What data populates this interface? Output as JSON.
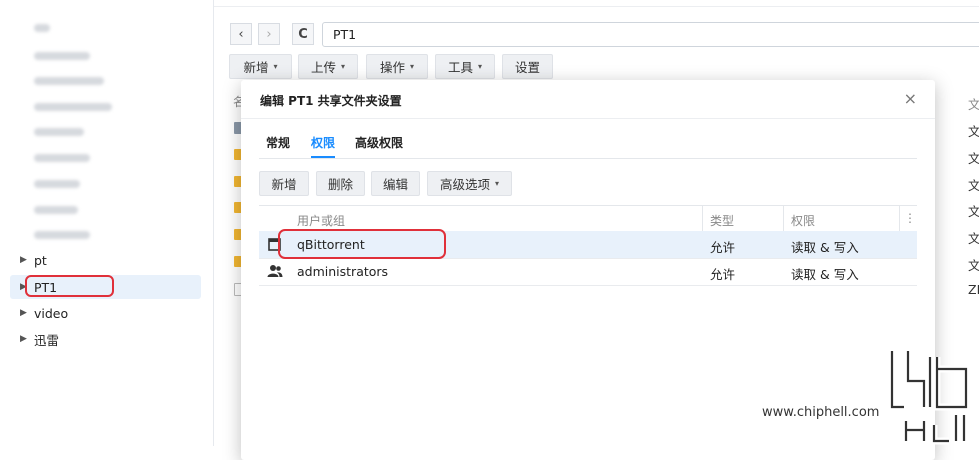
{
  "sidebar": {
    "items": [
      {
        "label": "pt",
        "expander": "▶"
      },
      {
        "label": "PT1",
        "expander": "▶"
      },
      {
        "label": "video",
        "expander": "▶"
      },
      {
        "label": "迅雷",
        "expander": "▶"
      }
    ]
  },
  "nav": {
    "back_icon": "‹",
    "forward_icon": "›",
    "refresh_icon": "C",
    "path_value": "PT1"
  },
  "toolbar": {
    "buttons": [
      {
        "label": "新增",
        "caret": "▾"
      },
      {
        "label": "上传",
        "caret": "▾"
      },
      {
        "label": "操作",
        "caret": "▾"
      },
      {
        "label": "工具",
        "caret": "▾"
      },
      {
        "label": "设置",
        "caret": ""
      }
    ],
    "header_fragment": "名"
  },
  "file_list": {
    "right_column_header": "文",
    "right_column_values": [
      "文",
      "文",
      "文",
      "文",
      "文",
      "文",
      "ZI"
    ]
  },
  "dialog": {
    "title": "编辑 PT1 共享文件夹设置",
    "close_icon": "×",
    "tabs": [
      "常规",
      "权限",
      "高级权限"
    ],
    "active_tab": "权限",
    "buttons": [
      {
        "label": "新增",
        "caret": ""
      },
      {
        "label": "删除",
        "caret": ""
      },
      {
        "label": "编辑",
        "caret": ""
      },
      {
        "label": "高级选项",
        "caret": "▾"
      }
    ],
    "columns": [
      "用户或组",
      "类型",
      "权限"
    ],
    "column_menu_icon": "⋮",
    "rows": [
      {
        "name": "qBittorrent",
        "type": "允许",
        "permission": "读取 & 写入",
        "icon": "user-window-icon"
      },
      {
        "name": "administrators",
        "type": "允许",
        "permission": "读取 & 写入",
        "icon": "group-icon"
      }
    ]
  },
  "colors": {
    "accent": "#1a8cff",
    "highlight": "#e0303a",
    "selection": "#e8f1fb"
  }
}
